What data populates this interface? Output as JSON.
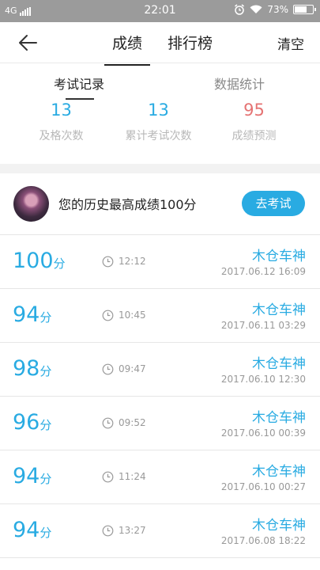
{
  "status_bar": {
    "network": "4G",
    "time": "22:01",
    "battery": "73%",
    "battery_level": 0.73
  },
  "header": {
    "tab_scores": "成绩",
    "tab_ranking": "排行榜",
    "clear": "清空"
  },
  "subtabs": {
    "records": "考试记录",
    "stats": "数据统计"
  },
  "stats": [
    {
      "value": "13",
      "label": "及格次数",
      "color": "#29abe2"
    },
    {
      "value": "13",
      "label": "累计考试次数",
      "color": "#29abe2"
    },
    {
      "value": "95",
      "label": "成绩预测",
      "color": "#e57373"
    }
  ],
  "best": {
    "text": "您的历史最高成绩100分",
    "button": "去考试"
  },
  "records": [
    {
      "score": "100",
      "unit": "分",
      "duration": "12:12",
      "name": "木仓车神",
      "date": "2017.06.12  16:09"
    },
    {
      "score": "94",
      "unit": "分",
      "duration": "10:45",
      "name": "木仓车神",
      "date": "2017.06.11  03:29"
    },
    {
      "score": "98",
      "unit": "分",
      "duration": "09:47",
      "name": "木仓车神",
      "date": "2017.06.10  12:30"
    },
    {
      "score": "96",
      "unit": "分",
      "duration": "09:52",
      "name": "木仓车神",
      "date": "2017.06.10  00:39"
    },
    {
      "score": "94",
      "unit": "分",
      "duration": "11:24",
      "name": "木仓车神",
      "date": "2017.06.10  00:27"
    },
    {
      "score": "94",
      "unit": "分",
      "duration": "13:27",
      "name": "木仓车神",
      "date": "2017.06.08  18:22"
    }
  ],
  "partial_name": "木仓车神",
  "colors": {
    "accent": "#29abe2",
    "prediction": "#e57373",
    "status_bar": "#9b9b9b"
  }
}
